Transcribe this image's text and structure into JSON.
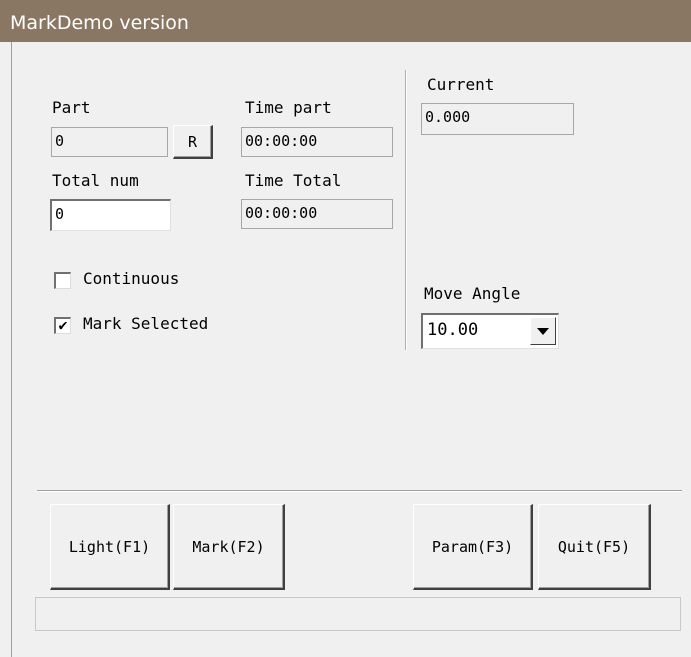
{
  "window": {
    "title": "MarkDemo version"
  },
  "labels": {
    "part": "Part",
    "time_part": "Time part",
    "total_num": "Total num",
    "time_total": "Time Total",
    "current": "Current",
    "move_angle": "Move Angle"
  },
  "fields": {
    "part_value": "0",
    "time_part_value": "00:00:00",
    "total_num_value": "0",
    "time_total_value": "00:00:00",
    "current_value": "0.000"
  },
  "reset_button": "R",
  "checkboxes": {
    "continuous": {
      "label": "Continuous",
      "checked": false
    },
    "mark_selected": {
      "label": "Mark Selected",
      "checked": true,
      "mark": "✔"
    }
  },
  "move_angle_combo": {
    "selected": "10.00"
  },
  "buttons": {
    "light": "Light(F1)",
    "mark": "Mark(F2)",
    "param": "Param(F3)",
    "quit": "Quit(F5)"
  },
  "status_bar": {
    "text": ""
  }
}
